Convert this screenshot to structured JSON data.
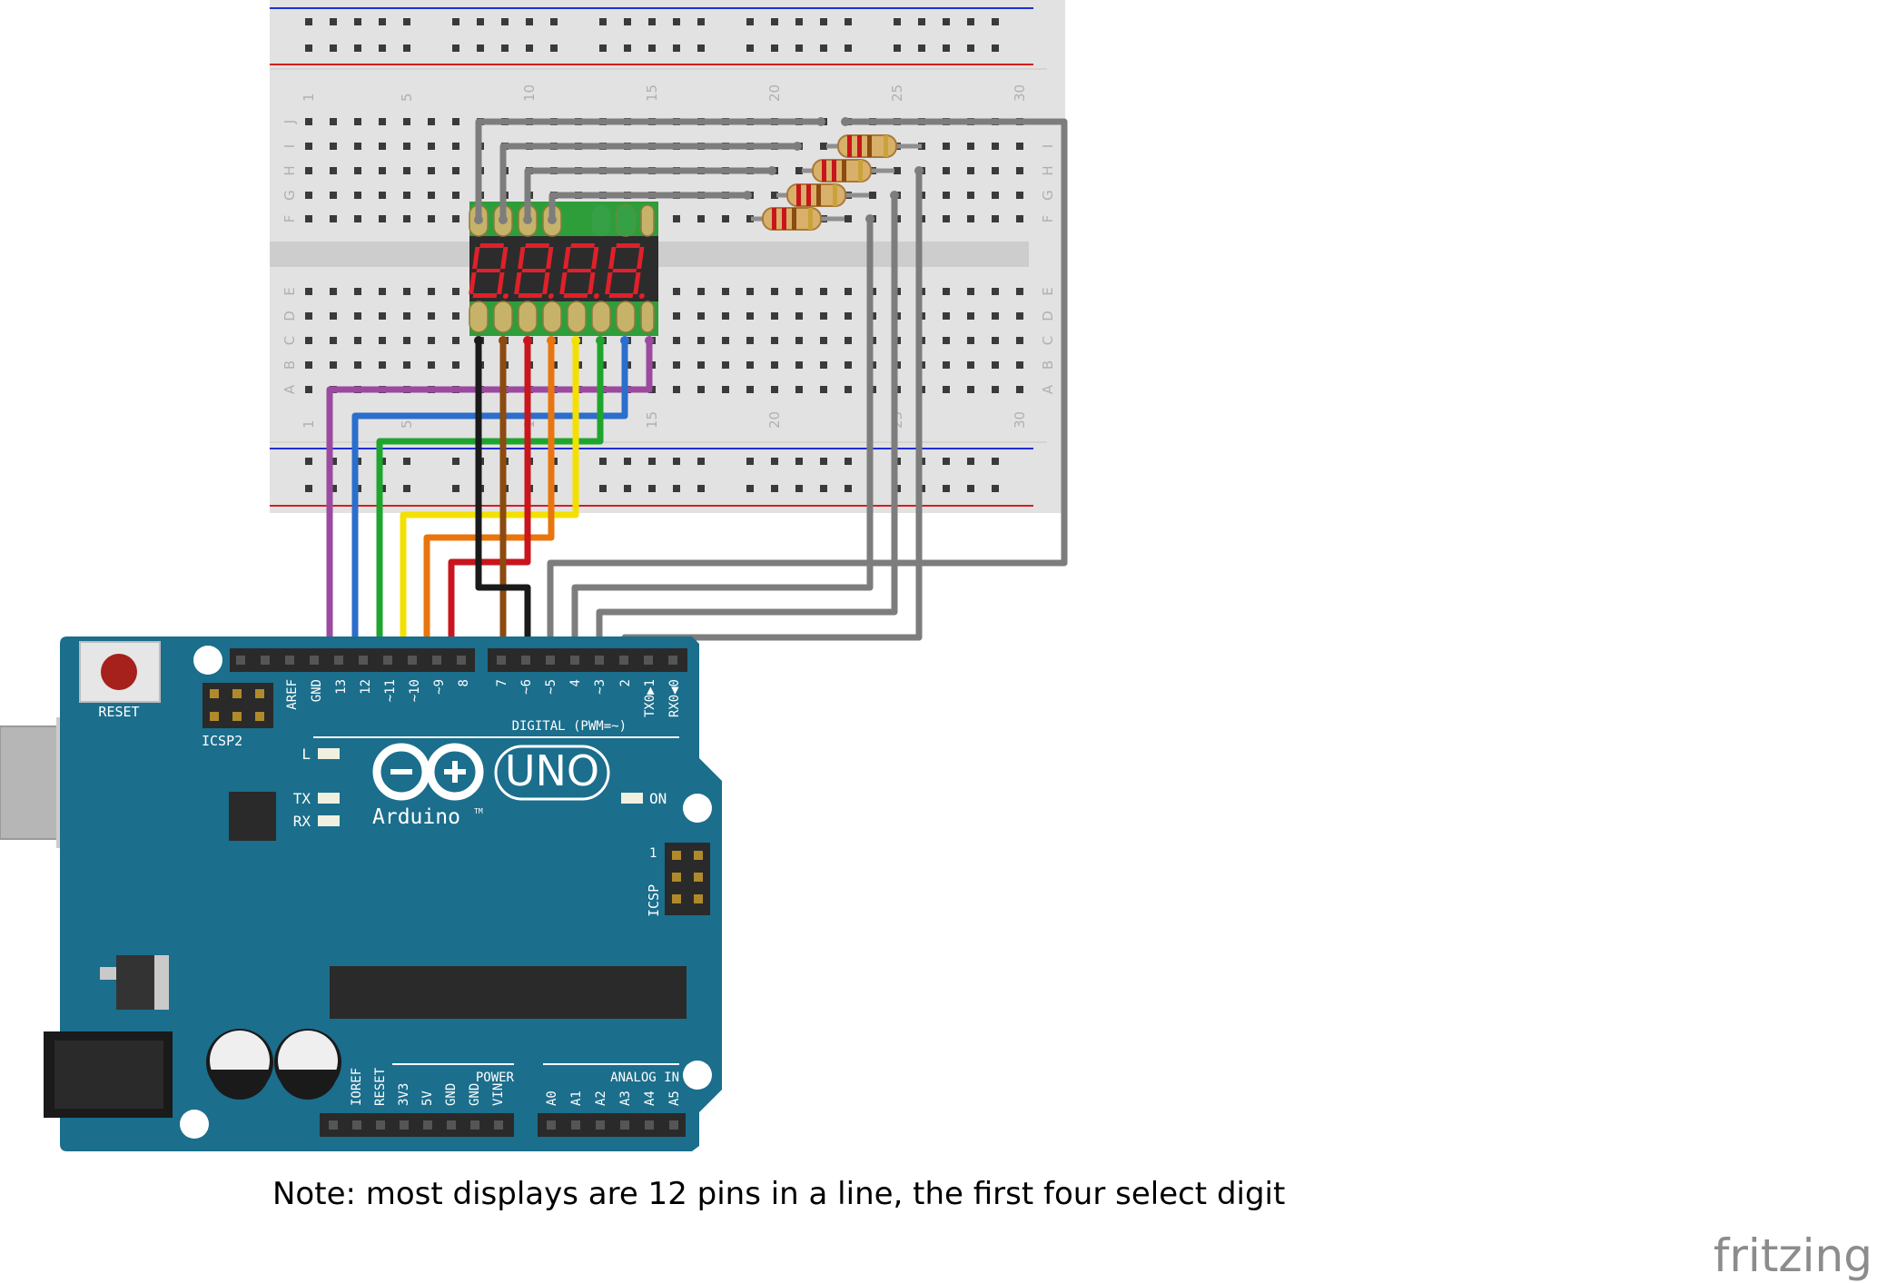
{
  "note": "Note: most displays are 12 pins in a line, the first four select digit",
  "brand": "fritzing",
  "breadboard": {
    "column_numbers": [
      "1",
      "5",
      "10",
      "15",
      "20",
      "25",
      "30"
    ],
    "row_letters_top": [
      "J",
      "I",
      "H",
      "G",
      "F"
    ],
    "row_letters_bottom": [
      "E",
      "D",
      "C",
      "B",
      "A"
    ]
  },
  "display": {
    "digits": [
      "8",
      "8",
      "8",
      "8"
    ],
    "segment_color": "#e0202a"
  },
  "arduino": {
    "reset_label": "RESET",
    "icsp2_label": "ICSP2",
    "icsp_label": "ICSP",
    "icsp_pin1": "1",
    "digital_label": "DIGITAL (PWM=~)",
    "digital_pins": [
      "AREF",
      "GND",
      "13",
      "12",
      "~11",
      "~10",
      "~9",
      "8",
      "7",
      "~6",
      "~5",
      "4",
      "~3",
      "2",
      "TX0▶1",
      "RX0◀0"
    ],
    "led_labels": [
      "L",
      "TX",
      "RX"
    ],
    "on_label": "ON",
    "brand": "Arduino",
    "trademark": "TM",
    "model": "UNO",
    "power_label": "POWER",
    "power_pins": [
      "IOREF",
      "RESET",
      "3V3",
      "5V",
      "GND",
      "GND",
      "VIN"
    ],
    "analog_label": "ANALOG IN",
    "analog_pins": [
      "A0",
      "A1",
      "A2",
      "A3",
      "A4",
      "A5"
    ],
    "board_color": "#1b6e8c"
  },
  "wire_colors": {
    "purple": "#9b4a9f",
    "blue": "#2c6ecb",
    "green": "#1fa52d",
    "yellow": "#f4e000",
    "orange": "#e8750e",
    "red": "#c8161c",
    "brown": "#8c4b10",
    "black": "#1a1a1a",
    "gray": "#7d7d7d"
  }
}
